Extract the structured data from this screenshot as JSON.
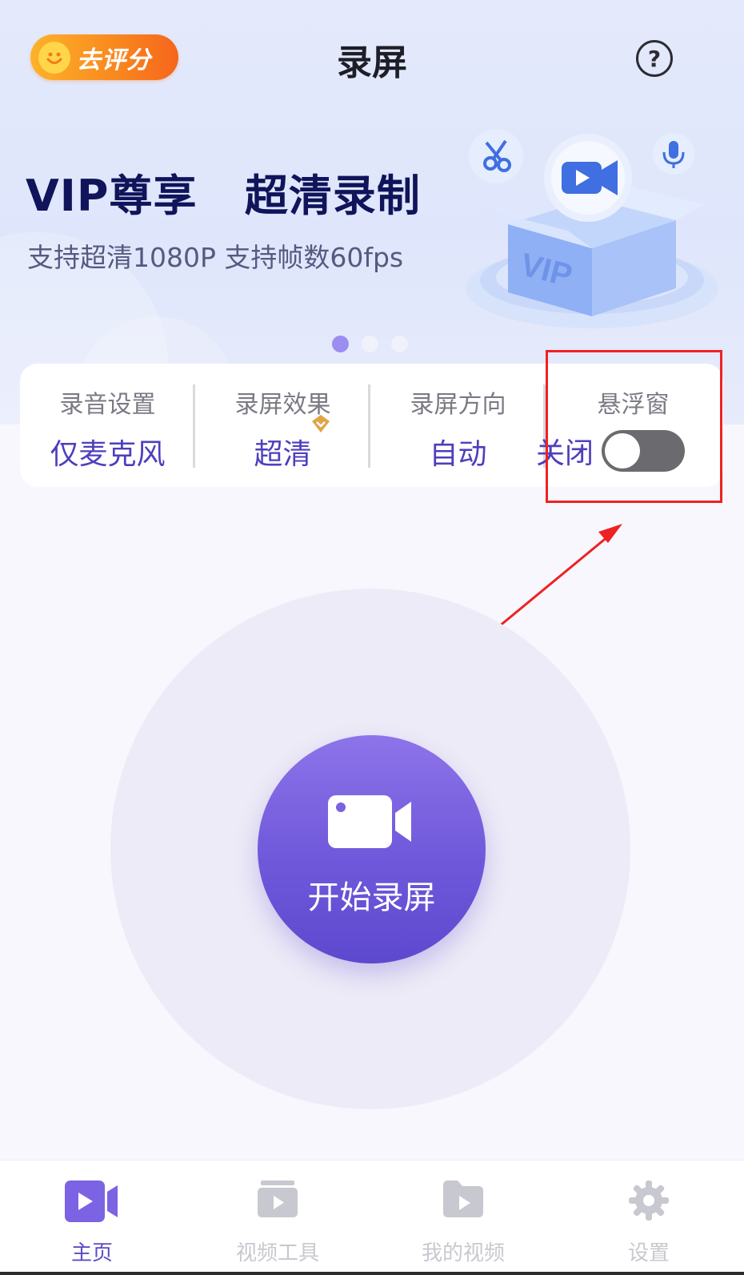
{
  "header": {
    "rate_label": "去评分",
    "title": "录屏",
    "help_symbol": "?"
  },
  "banner": {
    "headline": "VIP尊享   超清录制",
    "subline": "支持超清1080P 支持帧数60fps",
    "illustration_text": "VIP",
    "carousel": {
      "count": 3,
      "active_index": 0
    }
  },
  "settings": [
    {
      "label": "录音设置",
      "value": "仅麦克风"
    },
    {
      "label": "录屏效果",
      "value": "超清",
      "vip_badge_icon": "vip-diamond-icon"
    },
    {
      "label": "录屏方向",
      "value": "自动"
    },
    {
      "label": "悬浮窗",
      "value": "关闭",
      "toggle_on": false
    }
  ],
  "record_button": {
    "label": "开始录屏",
    "icon": "video-camera-icon"
  },
  "tabs": [
    {
      "label": "主页",
      "icon": "video-camera-icon",
      "active": true
    },
    {
      "label": "视频工具",
      "icon": "video-tools-icon",
      "active": false
    },
    {
      "label": "我的视频",
      "icon": "video-folder-icon",
      "active": false
    },
    {
      "label": "设置",
      "icon": "gear-icon",
      "active": false
    }
  ],
  "colors": {
    "accent": "#5a4cc6",
    "record_gradient_top": "#8d74ea",
    "record_gradient_bottom": "#5d49cf",
    "rate_orange": "#f98a1f",
    "annotation_red": "#ee2222",
    "toggle_off": "#6b6b6f"
  }
}
